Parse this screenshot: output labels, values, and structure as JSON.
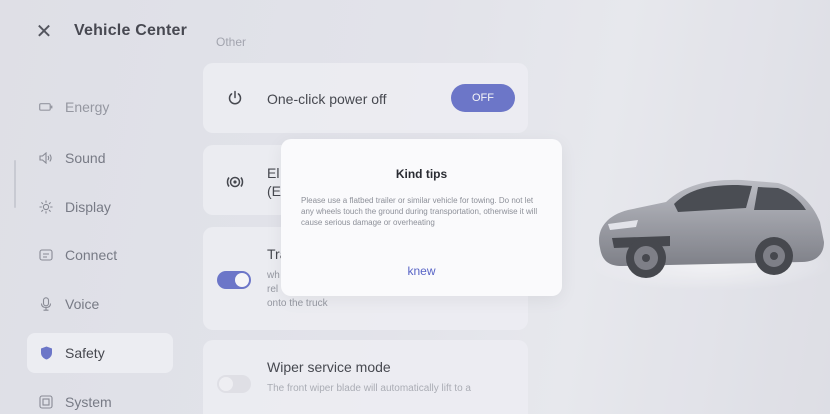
{
  "header": {
    "close_icon": "close-icon",
    "title": "Vehicle Center"
  },
  "sidebar": {
    "items": [
      {
        "label": "Energy",
        "icon": "battery-icon"
      },
      {
        "label": "Sound",
        "icon": "speaker-icon"
      },
      {
        "label": "Display",
        "icon": "brightness-icon"
      },
      {
        "label": "Connect",
        "icon": "connect-icon"
      },
      {
        "label": "Voice",
        "icon": "microphone-icon"
      },
      {
        "label": "Safety",
        "icon": "shield-icon",
        "active": true
      },
      {
        "label": "System",
        "icon": "system-icon"
      }
    ]
  },
  "main": {
    "section_label": "Other",
    "cards": [
      {
        "title": "One-click power off",
        "icon": "power-icon",
        "button": "OFF"
      },
      {
        "title_line1": "El",
        "title_line2": "(E",
        "icon": "parking-brake-icon"
      },
      {
        "title": "Tra",
        "icon": "tow-icon",
        "toggle": true,
        "desc_line1": "wh",
        "desc_line2": "rel",
        "desc_line3": "onto the truck"
      },
      {
        "title": "Wiper service mode",
        "toggle": false,
        "desc": "The front wiper blade will automatically lift to a"
      }
    ]
  },
  "dialog": {
    "title": "Kind tips",
    "body": "Please use a flatbed trailer or similar vehicle for towing. Do not let any wheels touch the ground during transportation, otherwise it will cause serious damage or overheating",
    "button": "knew"
  },
  "colors": {
    "accent": "#5864c6",
    "background": "#e8e9ef",
    "car_body": "#9a9ca3"
  }
}
